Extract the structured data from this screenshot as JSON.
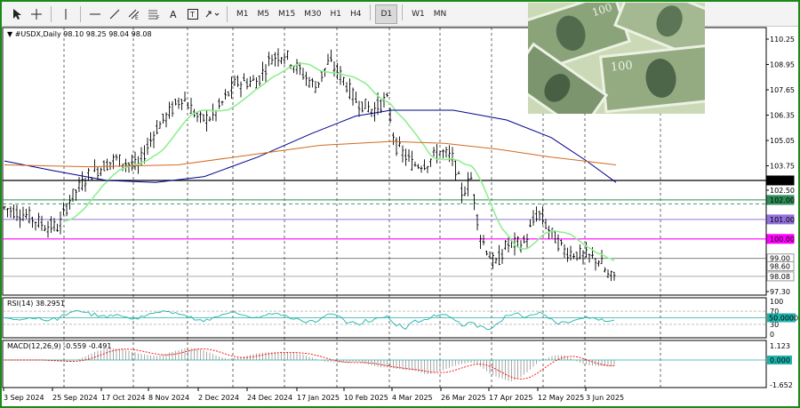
{
  "toolbar": {
    "timeframes": [
      "M1",
      "M5",
      "M15",
      "M30",
      "H1",
      "H4",
      "D1",
      "W1",
      "MN"
    ],
    "active_timeframe": "D1"
  },
  "chart": {
    "header": "#USDX,Daily  98.10 98.25 98.04 98.08",
    "rsi_header": "RSI(14) 38.2951",
    "macd_header": "MACD(12,26,9) -0.559 -0.491",
    "price_ticks": [
      "110.25",
      "108.95",
      "107.65",
      "106.35",
      "105.05",
      "103.75",
      "102.50",
      "97.30"
    ],
    "rsi_ticks": [
      "100",
      "70",
      "30",
      "0"
    ],
    "macd_ticks": [
      "1.123",
      "-1.652"
    ],
    "date_labels": [
      "3 Sep 2024",
      "25 Sep 2024",
      "17 Oct 2024",
      "8 Nov 2024",
      "2 Dec 2024",
      "24 Dec 2024",
      "17 Jan 2025",
      "10 Feb 2025",
      "4 Mar 2025",
      "26 Mar 2025",
      "17 Apr 2025",
      "12 May 2025",
      "3 Jun 2025"
    ],
    "level_labels": [
      {
        "text": "103.00",
        "bg": "#000000",
        "fg": "#ffffff"
      },
      {
        "text": "102.00",
        "bg": "#2e8b57",
        "fg": "#ffffff"
      },
      {
        "text": "101.00",
        "bg": "#9370db",
        "fg": "#ffffff"
      },
      {
        "text": "100.00",
        "bg": "#ff00ff",
        "fg": "#ffffff"
      },
      {
        "text": "99.00",
        "bg": "#ffffff",
        "fg": "#000000"
      },
      {
        "text": "98.60",
        "bg": "#ffffff",
        "fg": "#000000"
      },
      {
        "text": "98.08",
        "bg": "#ffffff",
        "fg": "#000000"
      }
    ],
    "rsi_level_label": "50.0000",
    "macd_level_label": "0.000",
    "colors": {
      "sma_fast": "#90ee90",
      "sma_mid": "#00008b",
      "sma_slow": "#d2691e",
      "rsi_line": "#20b2aa",
      "macd_hist": "#808080",
      "macd_signal": "#ff0000"
    }
  }
}
